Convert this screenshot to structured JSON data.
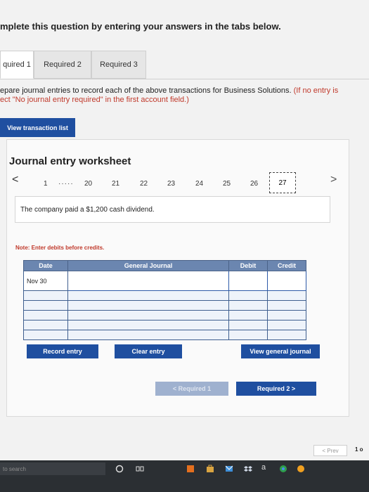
{
  "instruction": "mplete this question by entering your answers in the tabs below.",
  "tabs": [
    {
      "label": "quired 1",
      "active": true
    },
    {
      "label": "Required 2",
      "active": false
    },
    {
      "label": "Required 3",
      "active": false
    }
  ],
  "prep": {
    "line1_main": "epare journal entries to record each of the above transactions for Business Solutions. ",
    "line1_note": "(If no entry is",
    "line2_note": "ect \"No journal entry required\" in the first account field.)"
  },
  "view_transaction_list": "View transaction list",
  "worksheet": {
    "title": "Journal entry worksheet",
    "nav": {
      "prev_arrow": "<",
      "next_arrow": ">",
      "first": "1",
      "ellipsis": "·····",
      "items": [
        "20",
        "21",
        "22",
        "23",
        "24",
        "25",
        "26"
      ],
      "current": "27"
    },
    "transaction": "The company paid a $1,200 cash dividend.",
    "note": "Note: Enter debits before credits.",
    "columns": {
      "date": "Date",
      "account": "General Journal",
      "debit": "Debit",
      "credit": "Credit"
    },
    "rows": [
      {
        "date": "Nov 30",
        "account": "",
        "debit": "",
        "credit": ""
      },
      {
        "date": "",
        "account": "",
        "debit": "",
        "credit": ""
      },
      {
        "date": "",
        "account": "",
        "debit": "",
        "credit": ""
      },
      {
        "date": "",
        "account": "",
        "debit": "",
        "credit": ""
      },
      {
        "date": "",
        "account": "",
        "debit": "",
        "credit": ""
      },
      {
        "date": "",
        "account": "",
        "debit": "",
        "credit": ""
      }
    ],
    "buttons": {
      "record": "Record entry",
      "clear": "Clear entry",
      "view_journal": "View general journal"
    }
  },
  "footer_nav": {
    "prev": "< Required 1",
    "next": "Required 2  >"
  },
  "pager": {
    "prev": "< Prev",
    "page": "1 o"
  },
  "taskbar": {
    "search": "to search",
    "letter_icon": "a"
  },
  "colors": {
    "primary": "#1f4fa0",
    "note_red": "#c0392b",
    "header_blue": "#6b86b0"
  }
}
